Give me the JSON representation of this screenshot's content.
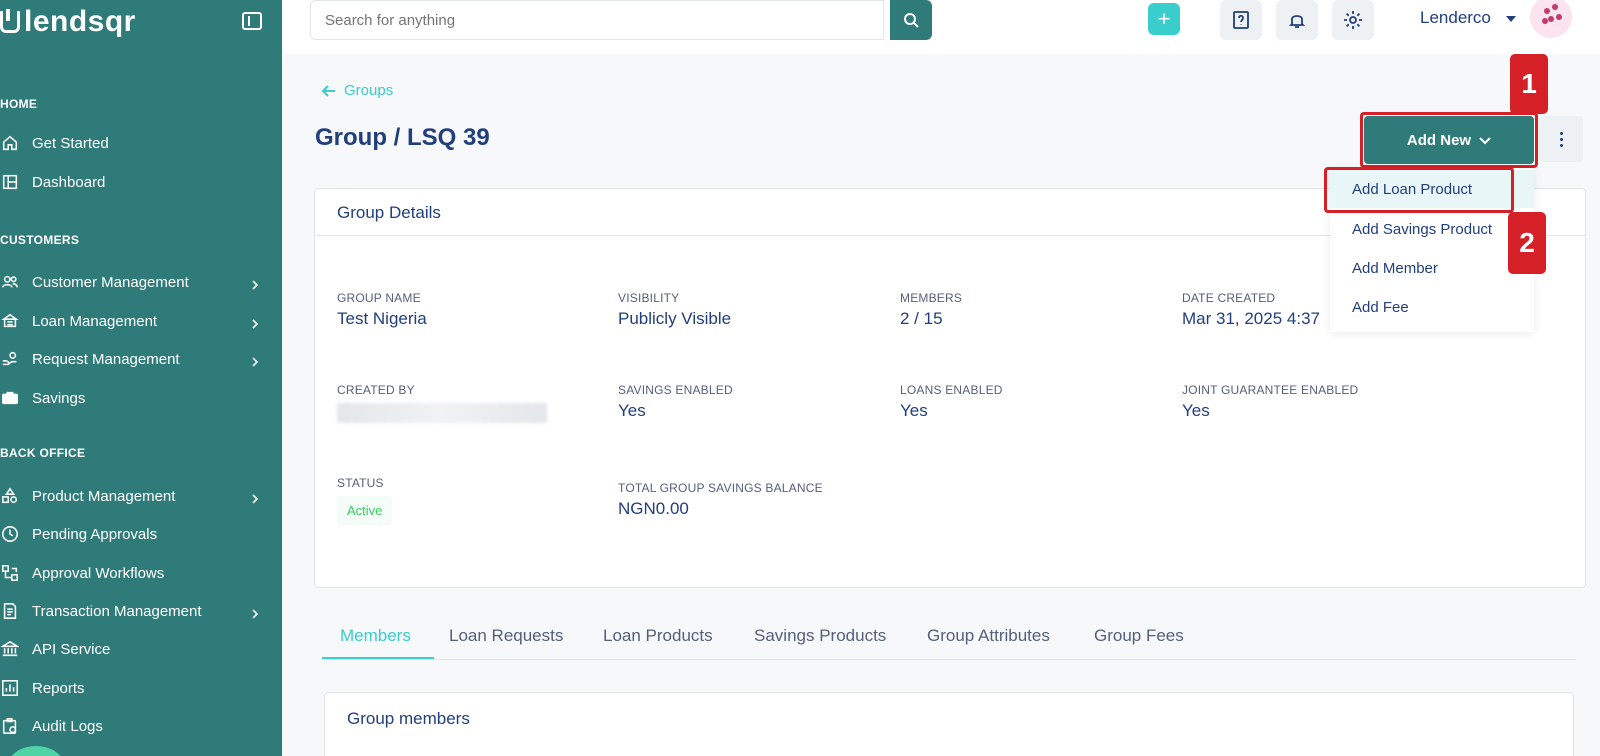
{
  "brand": {
    "name": "lendsqr"
  },
  "sidebar": {
    "sections": [
      {
        "label": "HOME"
      },
      {
        "label": "CUSTOMERS"
      },
      {
        "label": "BACK OFFICE"
      }
    ],
    "items": [
      {
        "label": "Get Started",
        "icon": "home-icon"
      },
      {
        "label": "Dashboard",
        "icon": "dashboard-icon"
      },
      {
        "label": "Customer Management",
        "icon": "users-icon"
      },
      {
        "label": "Loan Management",
        "icon": "loan-icon"
      },
      {
        "label": "Request Management",
        "icon": "request-icon"
      },
      {
        "label": "Savings",
        "icon": "briefcase-icon"
      },
      {
        "label": "Product Management",
        "icon": "shapes-icon"
      },
      {
        "label": "Pending Approvals",
        "icon": "clock-icon"
      },
      {
        "label": "Approval Workflows",
        "icon": "workflow-icon"
      },
      {
        "label": "Transaction Management",
        "icon": "transaction-icon"
      },
      {
        "label": "API Service",
        "icon": "bank-icon"
      },
      {
        "label": "Reports",
        "icon": "chart-icon"
      },
      {
        "label": "Audit Logs",
        "icon": "clipboard-icon"
      }
    ]
  },
  "topbar": {
    "search_placeholder": "Search for anything",
    "plus_label": "+",
    "user_name": "Lenderco"
  },
  "page": {
    "back_label": "Groups",
    "title": "Group / LSQ 39",
    "add_new_label": "Add New",
    "annotations": {
      "one": "1",
      "two": "2"
    }
  },
  "dropdown": {
    "items": [
      "Add Loan Product",
      "Add Savings Product",
      "Add Member",
      "Add Fee"
    ]
  },
  "details": {
    "header": "Group Details",
    "group_name_label": "GROUP NAME",
    "group_name": "Test Nigeria",
    "visibility_label": "VISIBILITY",
    "visibility": "Publicly Visible",
    "members_label": "MEMBERS",
    "members": "2 / 15",
    "date_created_label": "DATE CREATED",
    "date_created": "Mar 31, 2025 4:37",
    "created_by_label": "CREATED BY",
    "savings_enabled_label": "SAVINGS ENABLED",
    "savings_enabled": "Yes",
    "loans_enabled_label": "LOANS ENABLED",
    "loans_enabled": "Yes",
    "joint_guarantee_label": "JOINT GUARANTEE ENABLED",
    "joint_guarantee": "Yes",
    "status_label": "STATUS",
    "status": "Active",
    "savings_balance_label": "TOTAL GROUP SAVINGS BALANCE",
    "savings_balance": "NGN0.00"
  },
  "tabs": [
    "Members",
    "Loan Requests",
    "Loan Products",
    "Savings Products",
    "Group Attributes",
    "Group Fees"
  ],
  "members_section": {
    "title": "Group members"
  }
}
